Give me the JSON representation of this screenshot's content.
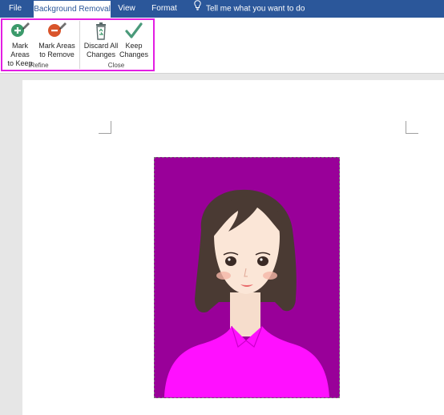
{
  "tabs": [
    {
      "label": "File",
      "active": false
    },
    {
      "label": "Background Removal",
      "active": true
    },
    {
      "label": "View",
      "active": false
    },
    {
      "label": "Format",
      "active": false
    }
  ],
  "tell_me": {
    "placeholder": "Tell me what you want to do",
    "icon": "lightbulb-icon"
  },
  "ribbon": {
    "groups": [
      {
        "label": "Refine",
        "buttons": [
          {
            "label": "Mark Areas\nto Keep",
            "icon": "plus-pencil-icon",
            "color": "#3c9a6b"
          },
          {
            "label": "Mark Areas\nto Remove",
            "icon": "minus-pencil-icon",
            "color": "#d9542b"
          }
        ]
      },
      {
        "label": "Close",
        "buttons": [
          {
            "label": "Discard All\nChanges",
            "icon": "recycle-bin-icon",
            "color": "#5a6a6a"
          },
          {
            "label": "Keep\nChanges",
            "icon": "checkmark-icon",
            "color": "#4a9a7a"
          }
        ]
      }
    ],
    "highlight_color": "#e31ee3"
  },
  "document": {
    "image": {
      "subject": "cartoon-woman-portrait",
      "background_color": "#990099",
      "shirt_color": "#ff10ff"
    }
  },
  "colors": {
    "accent": "#2b579a"
  }
}
